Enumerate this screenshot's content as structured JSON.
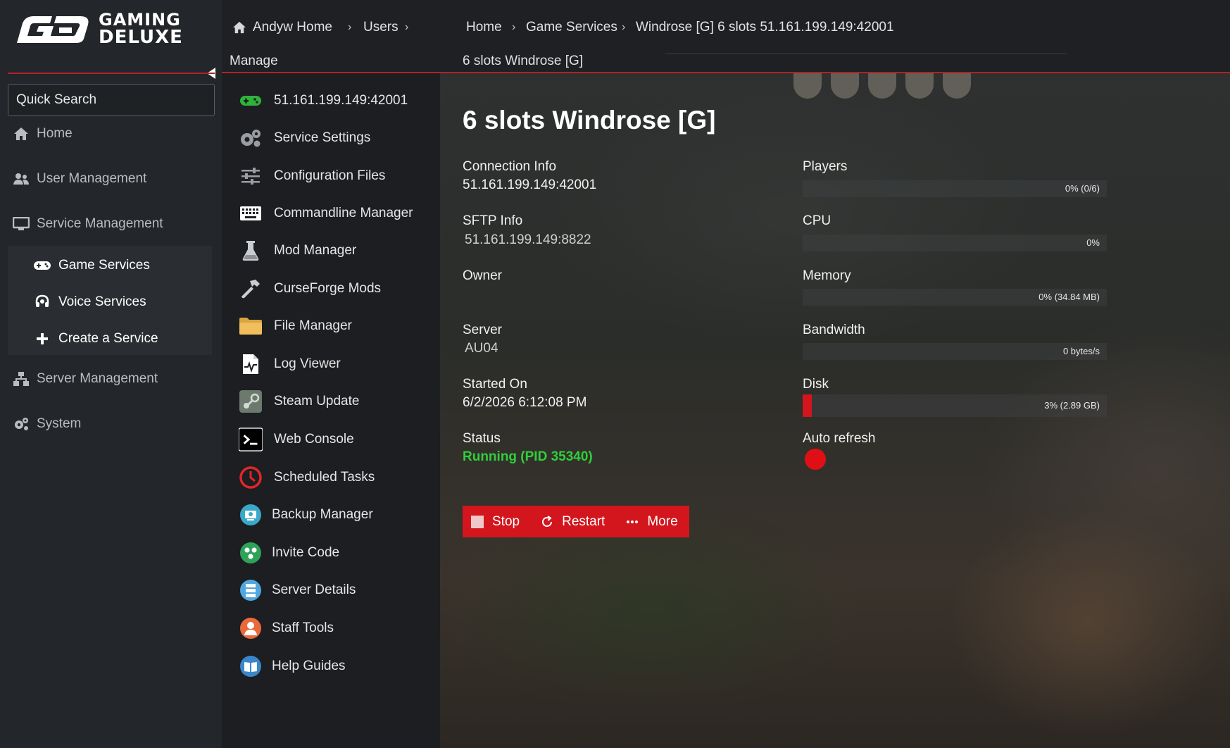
{
  "brand": {
    "line1": "GAMING",
    "line2": "DELUXE"
  },
  "sidebar": {
    "search_placeholder": "Quick Search",
    "items": [
      {
        "label": "Home",
        "icon": "home-icon"
      },
      {
        "label": "User Management",
        "icon": "users-icon"
      },
      {
        "label": "Service Management",
        "icon": "monitor-icon"
      },
      {
        "label": "Server Management",
        "icon": "network-icon"
      },
      {
        "label": "System",
        "icon": "gears-icon"
      }
    ],
    "sub_items": [
      {
        "label": "Game Services",
        "icon": "gamepad-icon"
      },
      {
        "label": "Voice Services",
        "icon": "headset-icon"
      },
      {
        "label": "Create a Service",
        "icon": "plus-icon"
      }
    ]
  },
  "breadcrumb_left": {
    "home": "Andyw Home",
    "users": "Users",
    "manage": "Manage"
  },
  "breadcrumb_right": {
    "home": "Home",
    "game_services": "Game Services",
    "current": "Windrose [G] 6 slots 51.161.199.149:42001",
    "subtitle": "6 slots Windrose [G]"
  },
  "manage_menu": [
    {
      "label": "51.161.199.149:42001",
      "icon": "gamepad-green-icon"
    },
    {
      "label": "Service Settings",
      "icon": "gears-icon"
    },
    {
      "label": "Configuration Files",
      "icon": "sliders-icon"
    },
    {
      "label": "Commandline Manager",
      "icon": "keyboard-icon"
    },
    {
      "label": "Mod Manager",
      "icon": "flask-icon"
    },
    {
      "label": "CurseForge Mods",
      "icon": "hammer-icon"
    },
    {
      "label": "File Manager",
      "icon": "folder-icon"
    },
    {
      "label": "Log Viewer",
      "icon": "log-icon"
    },
    {
      "label": "Steam Update",
      "icon": "steam-icon"
    },
    {
      "label": "Web Console",
      "icon": "terminal-icon"
    },
    {
      "label": "Scheduled Tasks",
      "icon": "clock-icon"
    },
    {
      "label": "Backup Manager",
      "icon": "backup-icon"
    },
    {
      "label": "Invite Code",
      "icon": "invite-icon"
    },
    {
      "label": "Server Details",
      "icon": "server-icon"
    },
    {
      "label": "Staff Tools",
      "icon": "staff-icon"
    },
    {
      "label": "Help Guides",
      "icon": "book-icon"
    }
  ],
  "service": {
    "title": "6 slots Windrose [G]",
    "connection_label": "Connection Info",
    "connection_value": "51.161.199.149:42001",
    "sftp_label": "SFTP Info",
    "sftp_value": "51.161.199.149:8822",
    "owner_label": "Owner",
    "server_label": "Server",
    "server_value": "AU04",
    "started_label": "Started On",
    "started_value": "6/2/2026 6:12:08 PM",
    "status_label": "Status",
    "status_value": "Running (PID 35340)",
    "status_color": "#2fcf3a"
  },
  "stats": {
    "players": {
      "label": "Players",
      "text": "0% (0/6)",
      "percent": 0
    },
    "cpu": {
      "label": "CPU",
      "text": "0%",
      "percent": 0
    },
    "memory": {
      "label": "Memory",
      "text": "0% (34.84 MB)",
      "percent": 0
    },
    "bandwidth": {
      "label": "Bandwidth",
      "text": "0 bytes/s",
      "percent": 0
    },
    "disk": {
      "label": "Disk",
      "text": "3% (2.89 GB)",
      "percent": 3
    },
    "auto_refresh_label": "Auto refresh",
    "auto_refresh_on": true
  },
  "actions": {
    "stop": "Stop",
    "restart": "Restart",
    "more": "More"
  },
  "colors": {
    "accent": "#d3161d",
    "running": "#2fcf3a"
  }
}
